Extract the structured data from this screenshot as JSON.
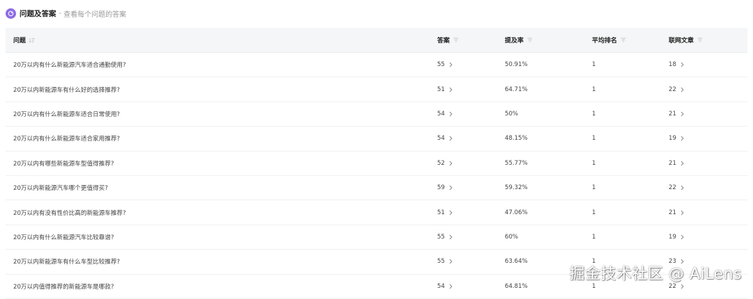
{
  "header": {
    "title": "问题及答案",
    "separator": "-",
    "subtitle": "查看每个问题的答案",
    "icon": "chat-bubble-icon",
    "icon_color": "#8e6ce6"
  },
  "table": {
    "columns": [
      {
        "label": "问题",
        "sort_icon": "sort-desc-icon"
      },
      {
        "label": "答案",
        "sort_icon": "filter-icon"
      },
      {
        "label": "提及率",
        "sort_icon": "filter-icon"
      },
      {
        "label": "平均排名",
        "sort_icon": "filter-icon"
      },
      {
        "label": "联网文章",
        "sort_icon": "filter-icon"
      }
    ],
    "rows": [
      {
        "question": "20万以内有什么新能源汽车适合通勤使用?",
        "answers": "55",
        "rate": "50.91%",
        "rank": "1",
        "articles": "18"
      },
      {
        "question": "20万以内新能源车有什么好的选择推荐?",
        "answers": "51",
        "rate": "64.71%",
        "rank": "1",
        "articles": "22"
      },
      {
        "question": "20万以内有什么新能源车适合日常使用?",
        "answers": "54",
        "rate": "50%",
        "rank": "1",
        "articles": "21"
      },
      {
        "question": "20万以内有什么新能源车适合家用推荐?",
        "answers": "54",
        "rate": "48.15%",
        "rank": "1",
        "articles": "19"
      },
      {
        "question": "20万以内有哪些新能源车型值得推荐?",
        "answers": "52",
        "rate": "55.77%",
        "rank": "1",
        "articles": "21"
      },
      {
        "question": "20万以内新能源汽车哪个更值得买?",
        "answers": "59",
        "rate": "59.32%",
        "rank": "1",
        "articles": "22"
      },
      {
        "question": "20万以内有没有性价比高的新能源车推荐?",
        "answers": "51",
        "rate": "47.06%",
        "rank": "1",
        "articles": "21"
      },
      {
        "question": "20万以内有什么新能源汽车比较靠谱?",
        "answers": "55",
        "rate": "60%",
        "rank": "1",
        "articles": "19"
      },
      {
        "question": "20万以内新能源车有什么车型比较推荐?",
        "answers": "55",
        "rate": "63.64%",
        "rank": "1",
        "articles": "23"
      },
      {
        "question": "20万以内值得推荐的新能源车是哪款?",
        "answers": "54",
        "rate": "64.81%",
        "rank": "1",
        "articles": "22"
      }
    ]
  },
  "watermark": "掘金技术社区 @ AiLens"
}
